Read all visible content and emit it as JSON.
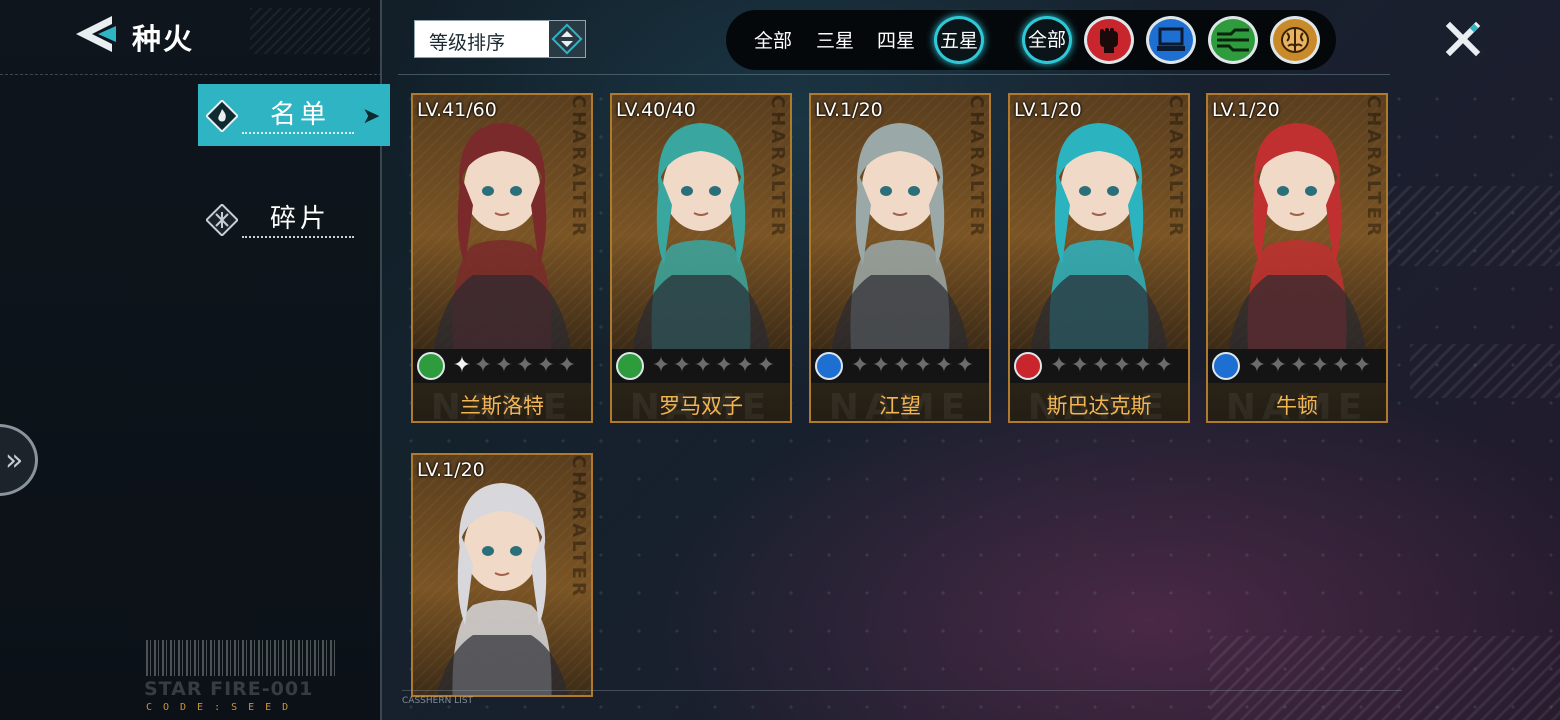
{
  "header": {
    "title": "种火",
    "tabs": [
      {
        "label": "名单",
        "active": true
      },
      {
        "label": "碎片",
        "active": false
      }
    ]
  },
  "sort": {
    "label": "等级排序"
  },
  "filters": {
    "stars": [
      {
        "label": "全部",
        "active": false
      },
      {
        "label": "三星",
        "active": false
      },
      {
        "label": "四星",
        "active": false
      },
      {
        "label": "五星",
        "active": true
      }
    ],
    "classes": [
      {
        "label": "全部",
        "icon": "all",
        "active": true
      },
      {
        "icon": "fist-icon",
        "color": "#c8262c"
      },
      {
        "icon": "computer-icon",
        "color": "#1d6fd2"
      },
      {
        "icon": "circuit-icon",
        "color": "#2e9b3c"
      },
      {
        "icon": "brain-icon",
        "color": "#c98a2a"
      }
    ]
  },
  "cards": [
    {
      "level": "LV.41/60",
      "class": "circuit-icon",
      "stars_lit": 0.5,
      "name": "兰斯洛特",
      "accent": "#7a2a2a"
    },
    {
      "level": "LV.40/40",
      "class": "circuit-icon",
      "stars_lit": 0,
      "name": "罗马双子",
      "accent": "#3aa6a0"
    },
    {
      "level": "LV.1/20",
      "class": "computer-icon",
      "stars_lit": 0,
      "name": "江望",
      "accent": "#9aa8a8"
    },
    {
      "level": "LV.1/20",
      "class": "fist-icon",
      "stars_lit": 0,
      "name": "斯巴达克斯",
      "accent": "#2bb3c0"
    },
    {
      "level": "LV.1/20",
      "class": "computer-icon",
      "stars_lit": 0,
      "name": "牛顿",
      "accent": "#c03030"
    },
    {
      "level": "LV.1/20",
      "class": "",
      "stars_lit": 0,
      "name": "",
      "accent": "#d8d8dc"
    }
  ],
  "card_watermark": "CHARALTER",
  "card_name_watermark": "NAME",
  "branding": {
    "line1": "STAR FIRE-001",
    "line2": "CODE:SEED",
    "footer": "CASSHERN LIST"
  },
  "colors": {
    "accent": "#2fb4c3",
    "card_border": "#b07a2c",
    "name_text": "#f2b553",
    "panel": "#0e151c"
  }
}
